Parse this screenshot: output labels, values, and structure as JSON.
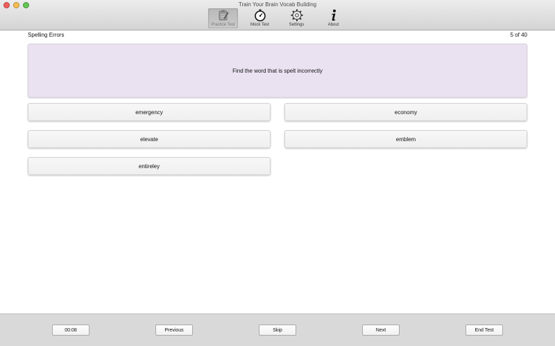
{
  "window": {
    "title": "Train Your Brain Vocab Building"
  },
  "toolbar": {
    "items": [
      {
        "label": "Practice Test",
        "icon": "clipboard-pencil-icon",
        "active": true
      },
      {
        "label": "Mock Test",
        "icon": "stopwatch-icon",
        "active": false
      },
      {
        "label": "Settings",
        "icon": "gear-icon",
        "active": false
      },
      {
        "label": "About",
        "icon": "info-icon",
        "active": false
      }
    ]
  },
  "header": {
    "section": "Spelling Errors",
    "progress": "5 of 40"
  },
  "question": {
    "text": "Find the word that is spelt incorrectly"
  },
  "options": [
    "emergency",
    "economy",
    "elevate",
    "emblem",
    "entireley"
  ],
  "footer": {
    "timer": "00:08",
    "previous": "Previous",
    "skip": "Skip",
    "next": "Next",
    "end": "End Test"
  },
  "colors": {
    "question_bg": "#eae2f0",
    "toolbar_bg": "#d4d4d4",
    "footer_bg": "#d9d9d9"
  }
}
